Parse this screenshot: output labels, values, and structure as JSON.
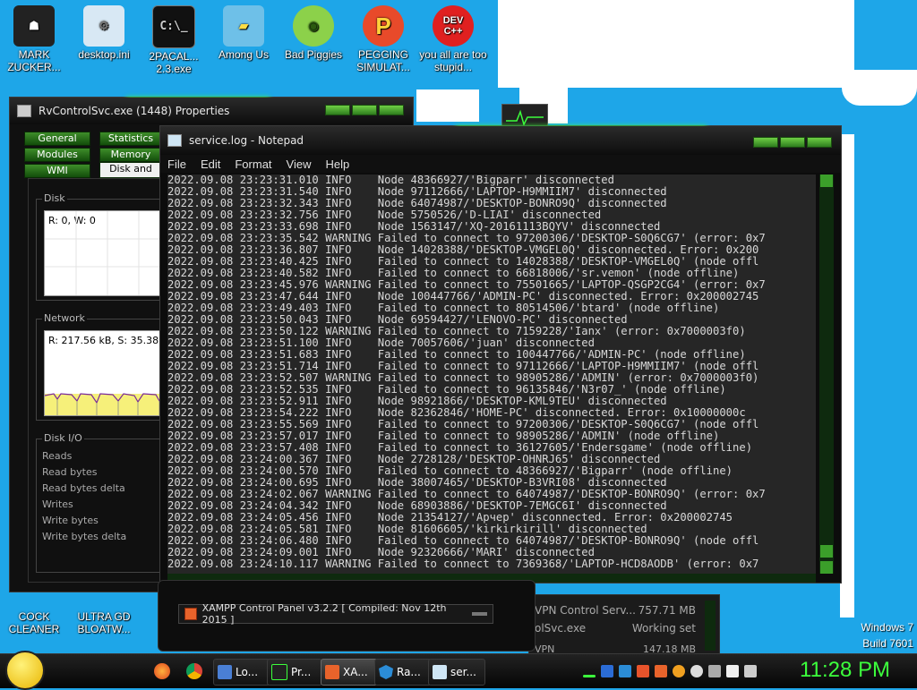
{
  "desktop": {
    "icons": [
      {
        "label": "MARK ZUCKER...",
        "name": "mark-zucker"
      },
      {
        "label": "desktop.ini",
        "name": "desktop-ini"
      },
      {
        "label": "2PACAL... 2.3.exe",
        "name": "2pacal-exe"
      },
      {
        "label": "Among Us",
        "name": "among-us"
      },
      {
        "label": "Bad Piggies",
        "name": "bad-piggies"
      },
      {
        "label": "PEGGING SIMULAT...",
        "name": "pegging-simulator"
      },
      {
        "label": "you all are too stupid...",
        "name": "dev-cpp"
      }
    ],
    "bottom_icons": [
      {
        "label": "COCK CLEANER",
        "name": "cock-cleaner"
      },
      {
        "label": "ULTRA GD BLOATW...",
        "name": "ultra-gd"
      }
    ],
    "os_label": "Windows 7",
    "build_label": "Build 7601"
  },
  "properties_window": {
    "title": "RvControlSvc.exe (1448) Properties",
    "tabs": [
      "General",
      "Statistics",
      "Modules",
      "Memory",
      "WMI",
      "Disk and"
    ],
    "disk": {
      "label": "Disk",
      "graph_text": "R: 0, W: 0"
    },
    "network": {
      "label": "Network",
      "graph_text": "R: 217.56 kB, S: 35.38 k"
    },
    "disk_io": {
      "label": "Disk I/O",
      "rows": [
        "Reads",
        "Read bytes",
        "Read bytes delta",
        "Writes",
        "Write bytes",
        "Write bytes delta"
      ]
    }
  },
  "process_list": {
    "rows": [
      {
        "name": "VPN Control Serv...",
        "value": "757.71 MB"
      },
      {
        "name": "olSvc.exe",
        "value": "Working set"
      },
      {
        "name": "VPN",
        "value": "147.18 MB"
      }
    ]
  },
  "notepad": {
    "title": "service.log - Notepad",
    "menu": [
      "File",
      "Edit",
      "Format",
      "View",
      "Help"
    ],
    "lines": [
      "2022.09.08 23:23:31.010 INFO    Node 48366927/'Bigparr' disconnected",
      "2022.09.08 23:23:31.540 INFO    Node 97112666/'LAPTOP-H9MMIIM7' disconnected",
      "2022.09.08 23:23:32.343 INFO    Node 64074987/'DESKTOP-BONRO9Q' disconnected",
      "2022.09.08 23:23:32.756 INFO    Node 5750526/'D-LIAI' disconnected",
      "2022.09.08 23:23:33.698 INFO    Node 1563147/'XQ-20161113BQYV' disconnected",
      "2022.09.08 23:23:35.542 WARNING Failed to connect to 97200306/'DESKTOP-S0Q6CG7' (error: 0x7",
      "2022.09.08 23:23:36.807 INFO    Node 14028388/'DESKTOP-VMGEL0Q' disconnected. Error: 0x200",
      "2022.09.08 23:23:40.425 INFO    Failed to connect to 14028388/'DESKTOP-VMGEL0Q' (node offl",
      "2022.09.08 23:23:40.582 INFO    Failed to connect to 66818006/'sr.vemon' (node offline)",
      "2022.09.08 23:23:45.976 WARNING Failed to connect to 75501665/'LAPTOP-QSGP2CG4' (error: 0x7",
      "2022.09.08 23:23:47.644 INFO    Node 100447766/'ADMIN-PC' disconnected. Error: 0x200002745",
      "2022.09.08 23:23:49.403 INFO    Failed to connect to 80514506/'btard' (node offline)",
      "2022.09.08 23:23:50.043 INFO    Node 69594427/'LENOVO-PC' disconnected",
      "2022.09.08 23:23:50.122 WARNING Failed to connect to 7159228/'Ianx' (error: 0x7000003f0)",
      "2022.09.08 23:23:51.100 INFO    Node 70057606/'juan' disconnected",
      "2022.09.08 23:23:51.683 INFO    Failed to connect to 100447766/'ADMIN-PC' (node offline)",
      "2022.09.08 23:23:51.714 INFO    Failed to connect to 97112666/'LAPTOP-H9MMIIM7' (node offl",
      "2022.09.08 23:23:52.507 WARNING Failed to connect to 98905286/'ADMIN' (error: 0x7000003f0)",
      "2022.09.08 23:23:52.535 INFO    Failed to connect to 96135846/'N3r07_' (node offline)",
      "2022.09.08 23:23:52.911 INFO    Node 98921866/'DESKTOP-KML9TEU' disconnected",
      "2022.09.08 23:23:54.222 INFO    Node 82362846/'HOME-PC' disconnected. Error: 0x10000000c",
      "2022.09.08 23:23:55.569 INFO    Failed to connect to 97200306/'DESKTOP-S0Q6CG7' (node offl",
      "2022.09.08 23:23:57.017 INFO    Failed to connect to 98905286/'ADMIN' (node offline)",
      "2022.09.08 23:23:57.408 INFO    Failed to connect to 36127605/'Endersgame' (node offline)",
      "2022.09.08 23:24:00.367 INFO    Node 2728128/'DESKTOP-OHNRJ65' disconnected",
      "2022.09.08 23:24:00.570 INFO    Failed to connect to 48366927/'Bigparr' (node offline)",
      "2022.09.08 23:24:00.695 INFO    Node 38007465/'DESKTOP-B3VRI08' disconnected",
      "2022.09.08 23:24:02.067 WARNING Failed to connect to 64074987/'DESKTOP-BONRO9Q' (error: 0x7",
      "2022.09.08 23:24:04.342 INFO    Node 68903886/'DESKTOP-7EMGC6I' disconnected",
      "2022.09.08 23:24:05.456 INFO    Node 21354127/'Арчер' disconnected. Error: 0x200002745",
      "2022.09.08 23:24:05.581 INFO    Node 81606605/'kirkirkirill' disconnected",
      "2022.09.08 23:24:06.480 INFO    Failed to connect to 64074987/'DESKTOP-BONRO9Q' (node offl",
      "2022.09.08 23:24:09.001 INFO    Node 92320666/'MARI' disconnected",
      "2022.09.08 23:24:10.117 WARNING Failed to connect to 7369368/'LAPTOP-HCD8AODB' (error: 0x7"
    ]
  },
  "xampp": {
    "title": "XAMPP Control Panel v3.2.2   [ Compiled: Nov 12th 2015 ]"
  },
  "taskbar": {
    "buttons": [
      {
        "label": "Lo...",
        "name": "taskbar-item-lo"
      },
      {
        "label": "Pr...",
        "name": "taskbar-item-process-hacker"
      },
      {
        "label": "XA...",
        "name": "taskbar-item-xampp"
      },
      {
        "label": "Ra...",
        "name": "taskbar-item-ra"
      },
      {
        "label": "ser...",
        "name": "taskbar-item-service-log"
      }
    ],
    "clock": "11:28 PM"
  },
  "colors": {
    "accent_green": "#3cff3c",
    "desktop_blue": "#1ea6e8"
  }
}
